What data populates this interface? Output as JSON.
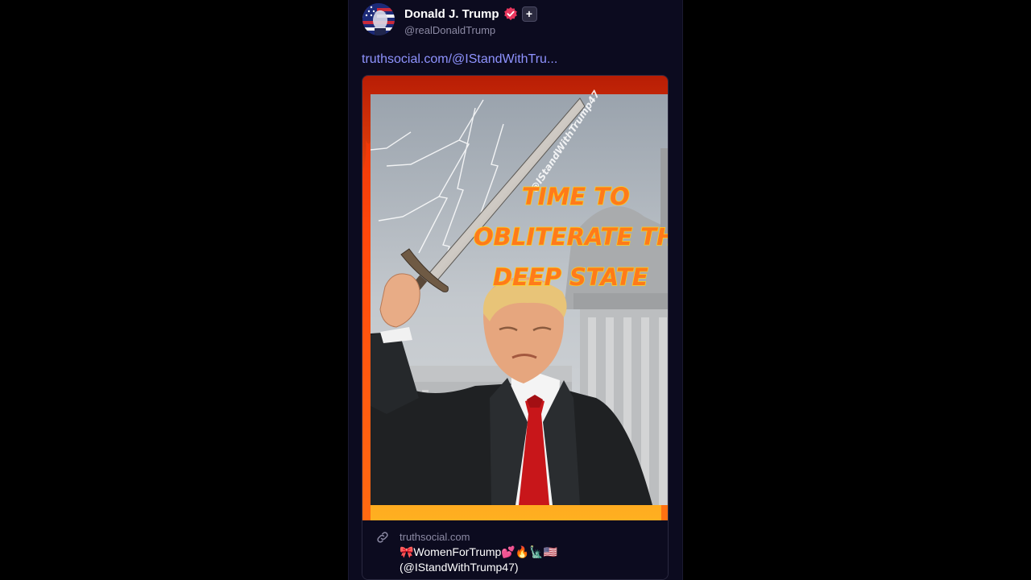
{
  "author": {
    "display_name": "Donald J. Trump",
    "handle": "@realDonaldTrump",
    "plus_badge": "+",
    "avatar_icon": "flag-portrait-avatar",
    "verified_icon": "verified-badge-icon",
    "verified_color": "#e8365d"
  },
  "post": {
    "link_text": "truthsocial.com/@IStandWithTru..."
  },
  "card": {
    "image": {
      "caption_lines": [
        "TIME TO",
        "OBLITERATE THE",
        "DEEP STATE"
      ],
      "watermark": "@IStandWithTrump47"
    },
    "link_icon": "link-icon",
    "domain": "truthsocial.com",
    "title_line1": "🎀WomenForTrump💕🔥🗽🇺🇸",
    "title_line2": "(@IStandWithTrump47)"
  },
  "colors": {
    "background": "#000000",
    "post_bg": "#0c0b1f",
    "link": "#8f93ff",
    "muted": "#8c8aa4",
    "caption_fill": "#ff7a1a"
  }
}
